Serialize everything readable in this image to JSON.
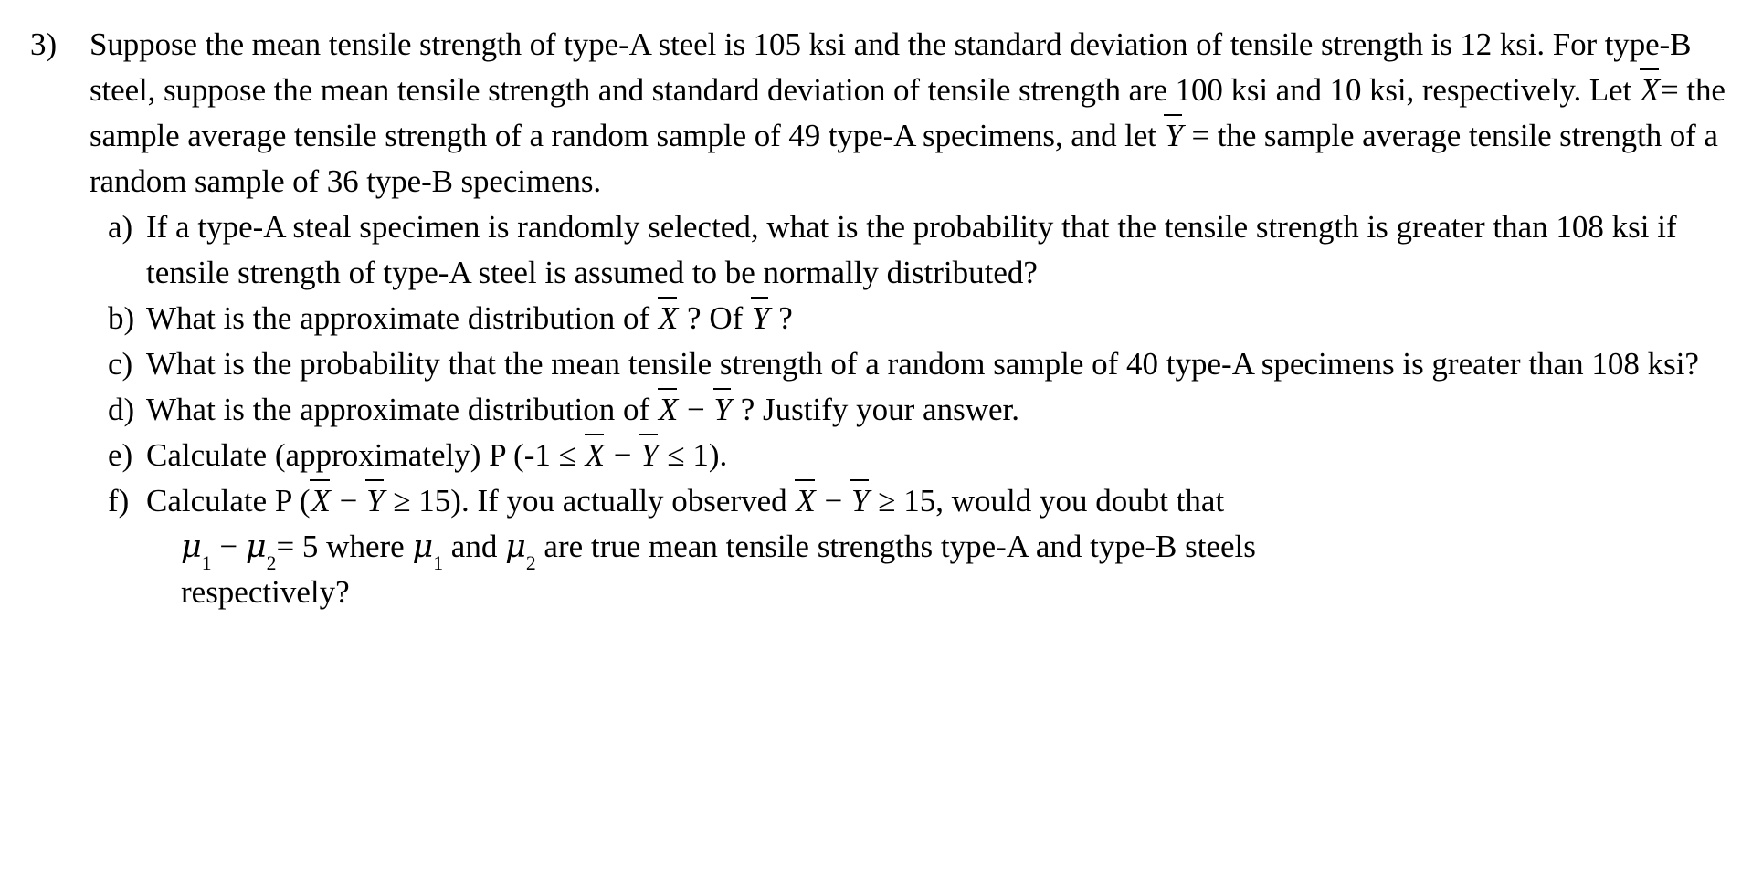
{
  "document": {
    "background_color": "#ffffff",
    "text_color": "#000000",
    "problem_number": "3)",
    "stem": {
      "part1": "Suppose the mean tensile strength of type-A steel is 105 ksi and the standard deviation of tensile strength is 12 ksi. For type-B steel, suppose the mean tensile strength and standard deviation of tensile strength are 100 ksi and 10 ksi, respectively. Let ",
      "xbar_1": "X",
      "part2": "= the sample average tensile strength of a random sample of 49 type-A specimens, and let ",
      "ybar_1": "Y",
      "part3": " = the sample average tensile strength of a random sample of 36 type-B specimens."
    },
    "subitems": [
      {
        "label": "a)",
        "text": "If a type-A steal specimen is randomly selected, what is the probability that the tensile strength is greater than 108 ksi if tensile strength of type-A steel is assumed to be normally distributed?"
      },
      {
        "label": "b)",
        "pre": "What is the approximate distribution of ",
        "xbar": "X",
        "mid": " ? Of ",
        "ybar": "Y",
        "post": " ?"
      },
      {
        "label": "c)",
        "text": "What is the probability that the mean tensile strength of a random sample of 40 type-A specimens is greater than 108 ksi?"
      },
      {
        "label": "d)",
        "pre": "What is the approximate distribution of ",
        "xbar": "X",
        "minus": " − ",
        "ybar": "Y",
        "post": " ? Justify your answer."
      },
      {
        "label": "e)",
        "pre": "Calculate (approximately) P (-1 ≤ ",
        "xbar": "X",
        "minus": " − ",
        "ybar": "Y",
        "post": " ≤ 1)."
      },
      {
        "label": "f)",
        "pre": "Calculate P (",
        "xbar_1": "X",
        "minus_1": " − ",
        "ybar_1": "Y",
        "mid_1": " ≥ 15). If you actually observed ",
        "xbar_2": "X",
        "minus_2": " − ",
        "ybar_2": "Y",
        "mid_2": " ≥ 15, would you doubt that",
        "mu_1": "μ",
        "mu_1_sub": "1",
        "mu_join": " − ",
        "mu_2": "μ",
        "mu_2_sub": "2",
        "mu_tail": "= 5 where ",
        "mu_3": "μ",
        "mu_3_sub": "1",
        "mu_and": "  and  ",
        "mu_4": "μ",
        "mu_4_sub": "2",
        "mu_rest": " are true mean tensile strengths  type-A and type-B steels",
        "last_line": "respectively?"
      }
    ]
  }
}
